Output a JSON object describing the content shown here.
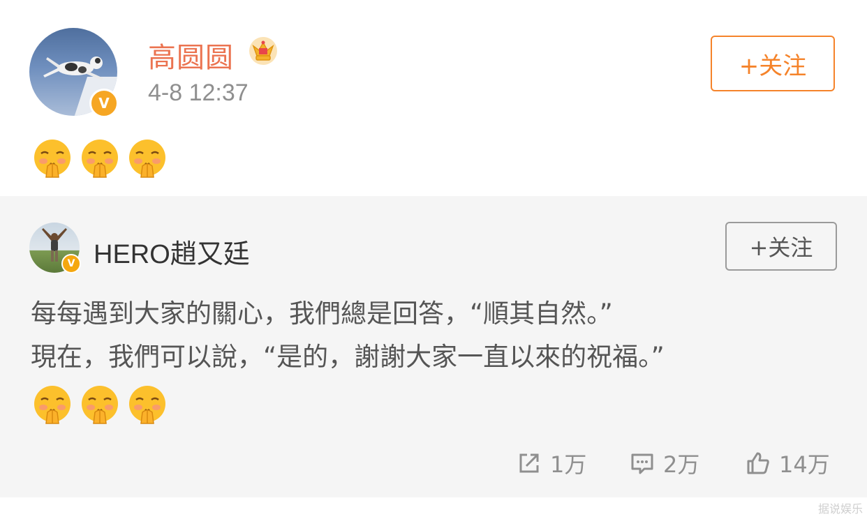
{
  "post": {
    "username": "高圆圆",
    "timestamp": "4-8 12:37",
    "follow_label": "+关注",
    "verified_mark": "V",
    "emojis": [
      "blushing-pray-emoji",
      "blushing-pray-emoji",
      "blushing-pray-emoji"
    ]
  },
  "repost": {
    "username": "HERO趙又廷",
    "follow_label": "+关注",
    "verified_mark": "V",
    "text_line1": "每每遇到大家的關心，我們總是回答，“順其自然。”",
    "text_line2": "現在，我們可以說，“是的，謝謝大家一直以來的祝福。”",
    "emojis": [
      "blushing-pray-emoji",
      "blushing-pray-emoji",
      "blushing-pray-emoji"
    ],
    "actions": {
      "repost_count": "1万",
      "comment_count": "2万",
      "like_count": "14万"
    }
  },
  "watermark": "据说娱乐",
  "colors": {
    "username_orange": "#eb7350",
    "follow_orange": "#f5832a",
    "verified_gold": "#f6a623",
    "repost_bg": "#f5f5f5",
    "muted_gray": "#8f8f8f"
  }
}
